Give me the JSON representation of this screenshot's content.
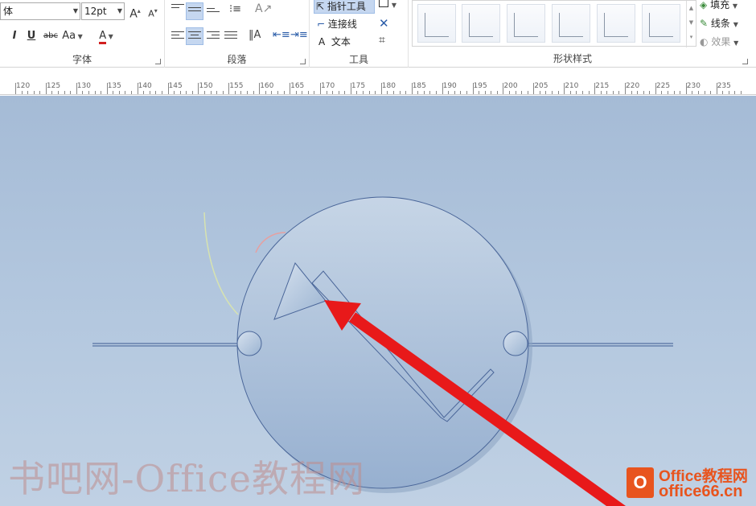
{
  "ribbon": {
    "font_group": {
      "label": "字体",
      "font_name": "体",
      "font_size": "12pt",
      "grow_label": "A",
      "shrink_label": "A",
      "italic_label": "I",
      "underline_label": "U",
      "strike_label": "abc",
      "case_label": "Aa",
      "color_label": "A",
      "font_color": "#d12020"
    },
    "paragraph_group": {
      "label": "段落"
    },
    "tools_group": {
      "label": "工具",
      "pointer_label": "指针工具",
      "connector_label": "连接线",
      "text_label": "文本",
      "text_glyph": "A"
    },
    "styles_group": {
      "label": "形状样式"
    },
    "format": {
      "fill_label": "填充",
      "line_label": "线条",
      "effect_label": "效果"
    }
  },
  "ruler": {
    "labels": [
      "120",
      "125",
      "130",
      "135",
      "140",
      "145",
      "150",
      "155",
      "160",
      "165",
      "170",
      "175",
      "180",
      "185",
      "190",
      "195",
      "200",
      "205",
      "210",
      "215",
      "220",
      "225",
      "230",
      "235"
    ]
  },
  "canvas": {
    "watermark": "书吧网-Office教程网",
    "logo": {
      "mark": "O",
      "title": "Office教程网",
      "domain": "office66.cn"
    }
  },
  "colors": {
    "accent": "#c5d7f0",
    "arrow": "#e8191a",
    "logo": "#e8541e"
  }
}
